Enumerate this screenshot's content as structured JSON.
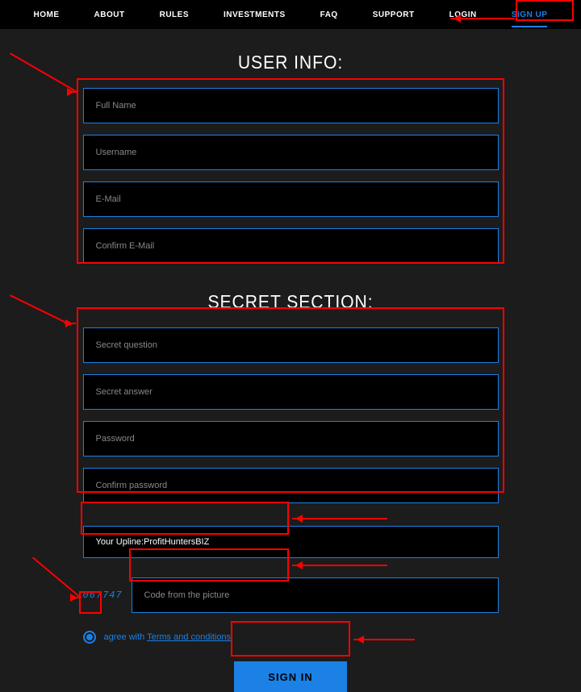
{
  "nav": {
    "home": "HOME",
    "about": "ABOUT",
    "rules": "RULES",
    "investments": "INVESTMENTS",
    "faq": "FAQ",
    "support": "SUPPORT",
    "login": "LOGIN",
    "signup": "SIGN UP"
  },
  "titles": {
    "user_info": "USER INFO:",
    "secret": "SECRET SECTION:"
  },
  "placeholders": {
    "full_name": "Full Name",
    "username": "Username",
    "email": "E-Mail",
    "confirm_email": "Confirm E-Mail",
    "secret_q": "Secret question",
    "secret_a": "Secret answer",
    "password": "Password",
    "confirm_password": "Confirm password",
    "captcha": "Code from the picture"
  },
  "upline": {
    "label": "Your Upline: ",
    "value": "ProfitHuntersBIZ"
  },
  "captcha_code": "067747",
  "agree": {
    "prefix": "agree with ",
    "link": "Terms and conditions"
  },
  "submit": "SIGN IN"
}
